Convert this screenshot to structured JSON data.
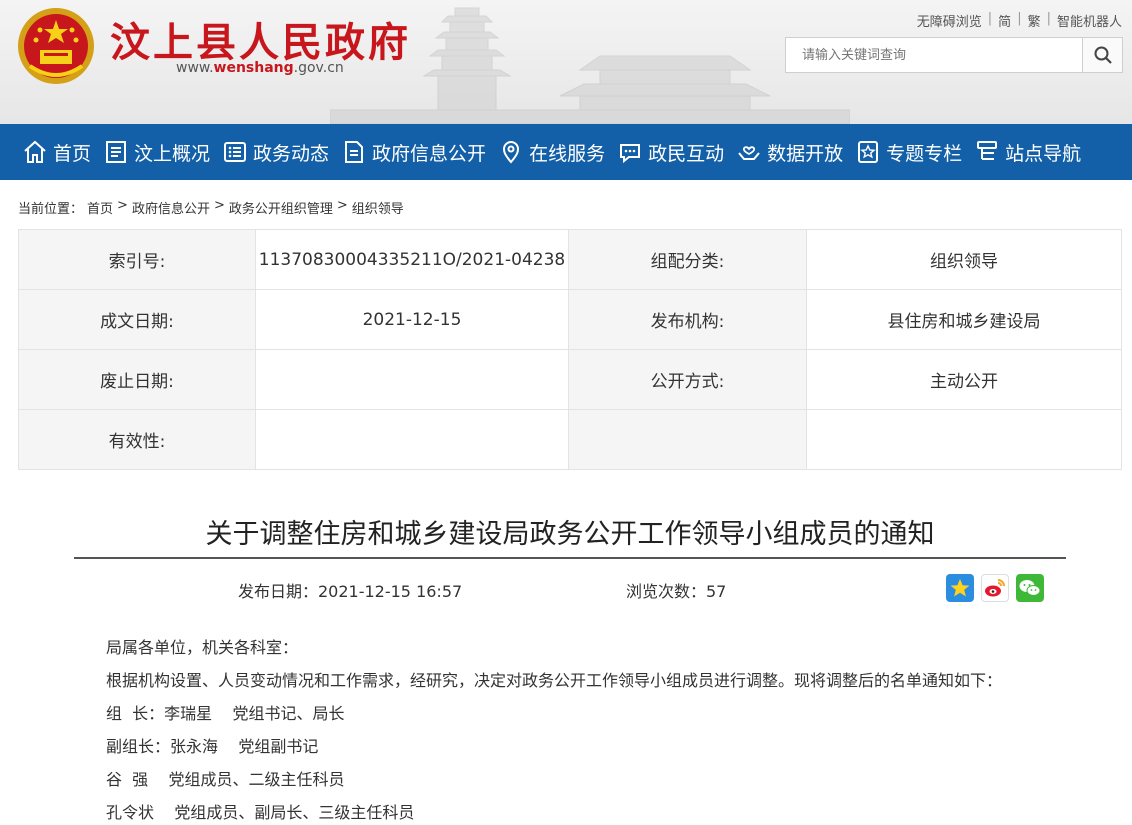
{
  "header": {
    "site_title": "汶上县人民政府",
    "url_prefix": "www.",
    "url_domain": "wenshang",
    "url_suffix": ".gov.cn",
    "top_links": [
      "无障碍浏览",
      "简",
      "繁",
      "智能机器人"
    ],
    "search_placeholder": "请输入关键词查询",
    "brand_color": "#c8161d"
  },
  "nav": {
    "color": "#1360a8",
    "items": [
      {
        "label": "首页",
        "icon": "home-icon"
      },
      {
        "label": "汶上概况",
        "icon": "document-icon"
      },
      {
        "label": "政务动态",
        "icon": "list-icon"
      },
      {
        "label": "政府信息公开",
        "icon": "file-icon"
      },
      {
        "label": "在线服务",
        "icon": "location-icon"
      },
      {
        "label": "政民互动",
        "icon": "chat-icon"
      },
      {
        "label": "数据开放",
        "icon": "hands-heart-icon"
      },
      {
        "label": "专题专栏",
        "icon": "star-badge-icon"
      },
      {
        "label": "站点导航",
        "icon": "sitemap-icon"
      }
    ]
  },
  "breadcrumb": {
    "prefix": "当前位置：",
    "items": [
      "首页",
      "政府信息公开",
      "政务公开组织管理",
      "组织领导"
    ],
    "separator": ">"
  },
  "info": {
    "rows": [
      {
        "l1": "索引号:",
        "v1": "11370830004335211O/2021-04238",
        "l2": "组配分类:",
        "v2": "组织领导"
      },
      {
        "l1": "成文日期:",
        "v1": "2021-12-15",
        "l2": "发布机构:",
        "v2": "县住房和城乡建设局"
      },
      {
        "l1": "废止日期:",
        "v1": "",
        "l2": "公开方式:",
        "v2": "主动公开"
      },
      {
        "l1": "有效性:",
        "v1": "",
        "l2": "",
        "v2": ""
      }
    ]
  },
  "article": {
    "title": "关于调整住房和城乡建设局政务公开工作领导小组成员的通知",
    "publish_date": "发布日期：2021-12-15 16:57",
    "views": "浏览次数：57",
    "share_icons": [
      "qzone-star-icon",
      "weibo-icon",
      "wechat-icon"
    ],
    "paragraphs": [
      "局属各单位，机关各科室：",
      "根据机构设置、人员变动情况和工作需求，经研究，决定对政务公开工作领导小组成员进行调整。现将调整后的名单通知如下：",
      "组  长：李瑞星    党组书记、局长",
      "副组长：张永海    党组副书记",
      "谷  强    党组成员、二级主任科员",
      "孔令状    党组成员、副局长、三级主任科员"
    ]
  }
}
